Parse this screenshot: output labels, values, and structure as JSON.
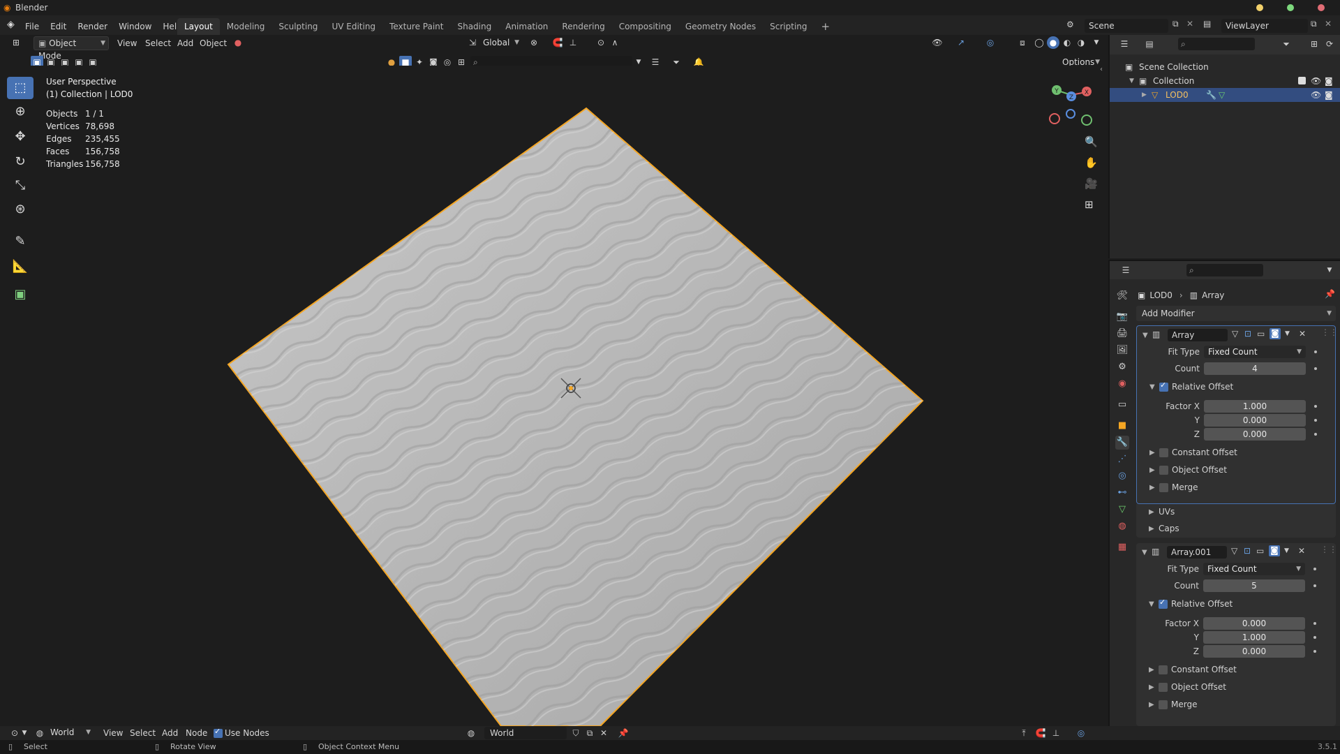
{
  "app": {
    "title": "Blender",
    "version": "3.5.1"
  },
  "menu": [
    "File",
    "Edit",
    "Render",
    "Window",
    "Help"
  ],
  "workspaces": [
    "Layout",
    "Modeling",
    "Sculpting",
    "UV Editing",
    "Texture Paint",
    "Shading",
    "Animation",
    "Rendering",
    "Compositing",
    "Geometry Nodes",
    "Scripting"
  ],
  "scene": {
    "name": "Scene",
    "view_layer": "ViewLayer"
  },
  "viewport_header": {
    "mode": "Object Mode",
    "menus": [
      "View",
      "Select",
      "Add",
      "Object"
    ],
    "orientation": "Global",
    "options": "Options"
  },
  "overlay_text": {
    "perspective": "User Perspective",
    "collection": "(1) Collection | LOD0"
  },
  "stats": [
    {
      "label": "Objects",
      "value": "1 / 1"
    },
    {
      "label": "Vertices",
      "value": "78,698"
    },
    {
      "label": "Edges",
      "value": "235,455"
    },
    {
      "label": "Faces",
      "value": "156,758"
    },
    {
      "label": "Triangles",
      "value": "156,758"
    }
  ],
  "outliner": {
    "root": "Scene Collection",
    "collection": "Collection",
    "object": "LOD0"
  },
  "properties": {
    "breadcrumb_object": "LOD0",
    "breadcrumb_modifier": "Array",
    "add_modifier": "Add Modifier",
    "modifiers": [
      {
        "name": "Array",
        "fit_type_label": "Fit Type",
        "fit_type": "Fixed Count",
        "count_label": "Count",
        "count": "4",
        "relative_offset": "Relative Offset",
        "factor_x_label": "Factor X",
        "factor_x": "1.000",
        "y_label": "Y",
        "y": "0.000",
        "z_label": "Z",
        "z": "0.000",
        "subpanels": [
          "Constant Offset",
          "Object Offset",
          "Merge",
          "UVs",
          "Caps"
        ]
      },
      {
        "name": "Array.001",
        "fit_type_label": "Fit Type",
        "fit_type": "Fixed Count",
        "count_label": "Count",
        "count": "5",
        "relative_offset": "Relative Offset",
        "factor_x_label": "Factor X",
        "factor_x": "0.000",
        "y_label": "Y",
        "y": "1.000",
        "z_label": "Z",
        "z": "0.000",
        "subpanels": [
          "Constant Offset",
          "Object Offset",
          "Merge"
        ]
      }
    ]
  },
  "node_header": {
    "world_type": "World",
    "menus": [
      "View",
      "Select",
      "Add",
      "Node"
    ],
    "use_nodes": "Use Nodes",
    "world_name": "World"
  },
  "statusbar": {
    "select": "Select",
    "rotate": "Rotate View",
    "context": "Object Context Menu"
  },
  "colors": {
    "accent": "#4772b3",
    "selection": "#f5a623",
    "active_row": "#334d80"
  }
}
